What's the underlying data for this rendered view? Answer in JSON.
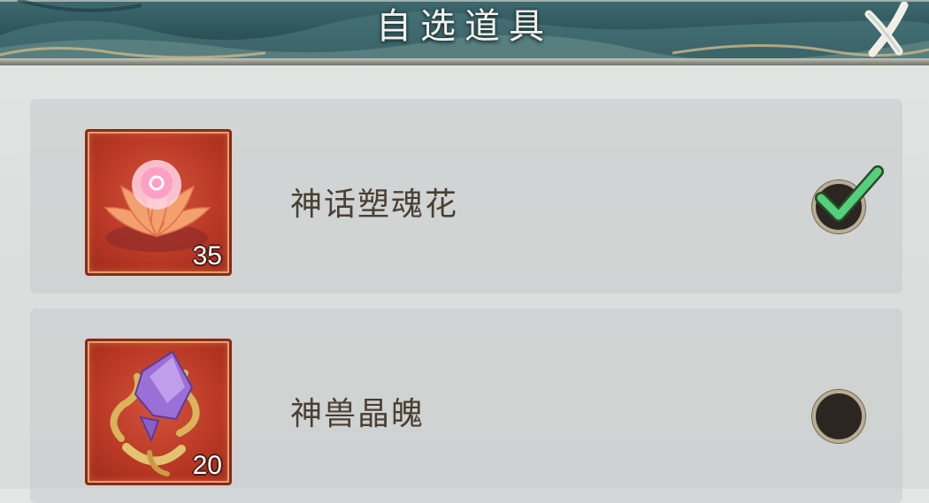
{
  "dialog": {
    "title": "自选道具",
    "close_icon": "close-x-icon"
  },
  "items": [
    {
      "name": "神话塑魂花",
      "quantity": "35",
      "icon": "lotus-flower-icon",
      "selected": true
    },
    {
      "name": "神兽晶魄",
      "quantity": "20",
      "icon": "purple-crystal-icon",
      "selected": false
    }
  ],
  "colors": {
    "header": "#2c5258",
    "item_frame": "#b83825",
    "check": "#4fd07a",
    "text": "#4a3f33"
  }
}
